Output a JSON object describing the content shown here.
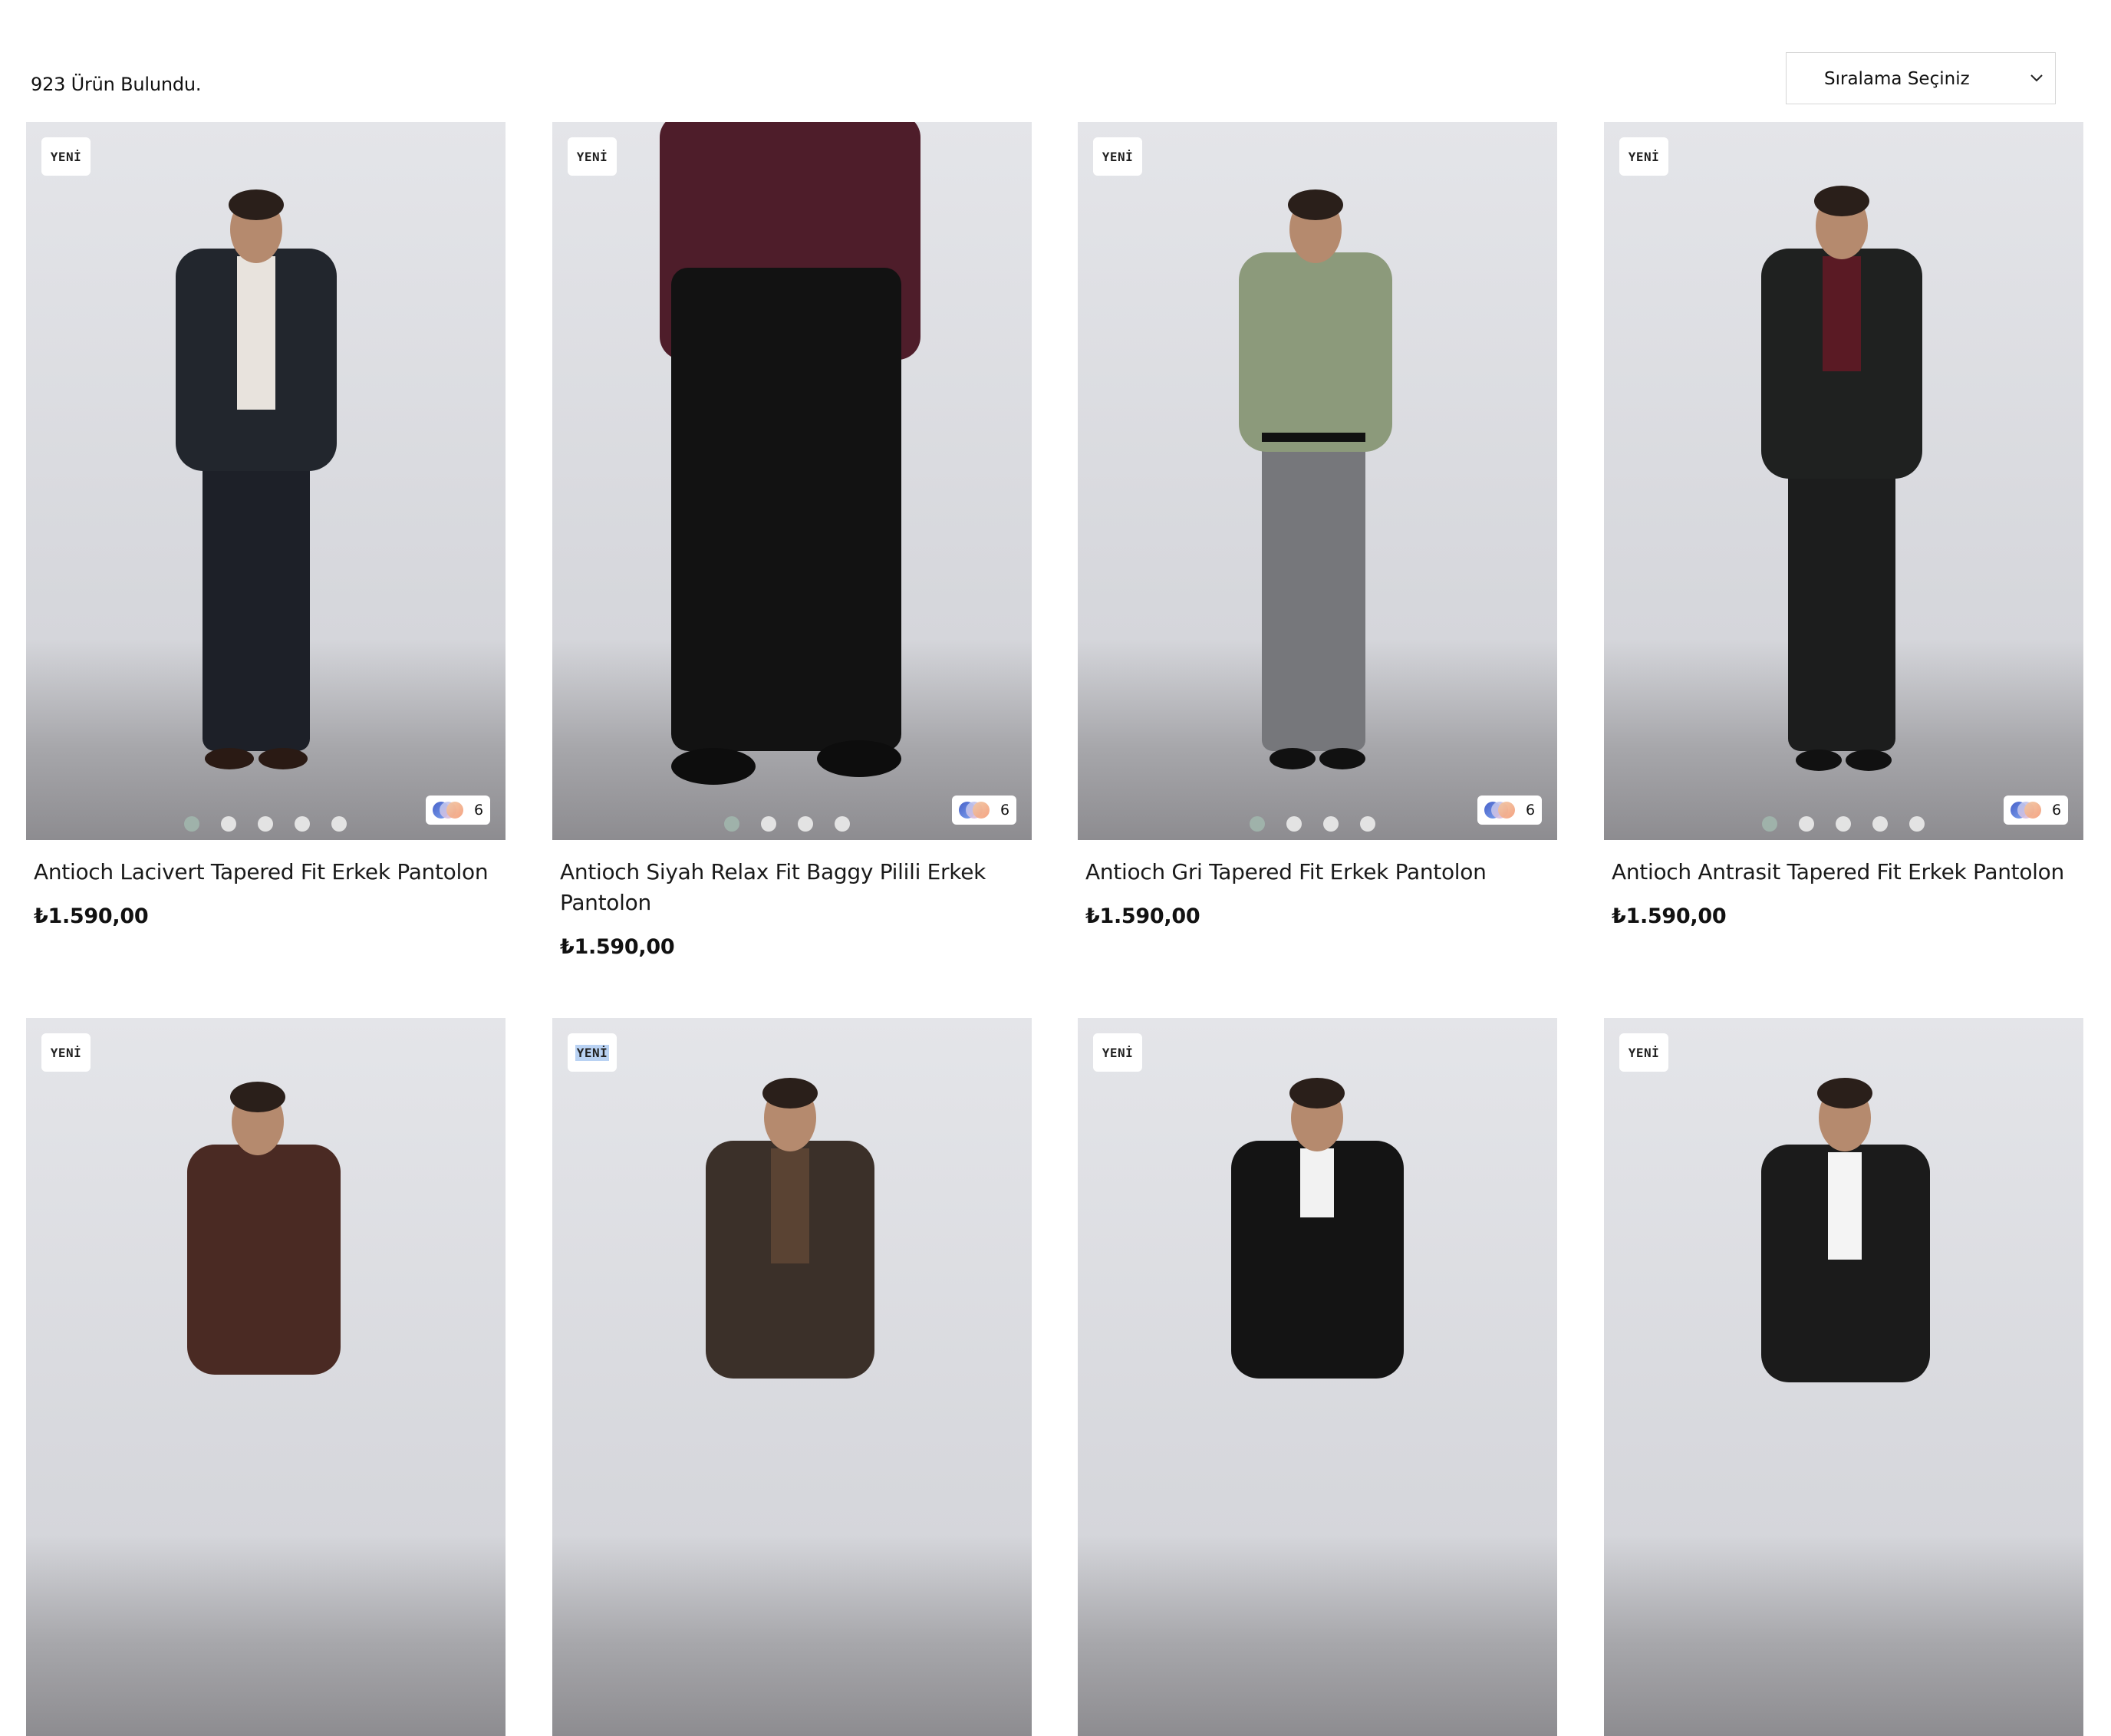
{
  "toolbar": {
    "result_count": "923 Ürün Bulundu.",
    "sort_label": "Sıralama Seçiniz"
  },
  "products": [
    {
      "badge": "YENİ",
      "name": "Antioch Lacivert Tapered Fit Erkek Pantolon",
      "price": "₺1.590,00",
      "color_count": "6",
      "image_count": 5,
      "top_color": "#e8e3dd",
      "jacket_color": "#22262d",
      "pants_color": "#1d2028"
    },
    {
      "badge": "YENİ",
      "name": "Antioch Siyah Relax Fit Baggy Pilili Erkek Pantolon",
      "price": "₺1.590,00",
      "color_count": "6",
      "image_count": 4,
      "top_color": "#4e1d2a",
      "jacket_color": "#4e1d2a",
      "pants_color": "#121212"
    },
    {
      "badge": "YENİ",
      "name": "Antioch Gri Tapered Fit Erkek Pantolon",
      "price": "₺1.590,00",
      "color_count": "6",
      "image_count": 4,
      "top_color": "#8c9a7b",
      "jacket_color": "#8c9a7b",
      "pants_color": "#76777b"
    },
    {
      "badge": "YENİ",
      "name": "Antioch Antrasit Tapered Fit Erkek Pantolon",
      "price": "₺1.590,00",
      "color_count": "6",
      "image_count": 5,
      "top_color": "#5a1a24",
      "jacket_color": "#1f2120",
      "pants_color": "#1c1d1d"
    },
    {
      "badge": "YENİ",
      "top_color": "#4a2a23",
      "jacket_color": "#4a2a23",
      "pants_color": "#2a2a2a"
    },
    {
      "badge": "YENİ",
      "top_color": "#5a4333",
      "jacket_color": "#3b3029",
      "pants_color": "#3b3029"
    },
    {
      "badge": "YENİ",
      "top_color": "#f2f2f2",
      "jacket_color": "#141414",
      "pants_color": "#141414"
    },
    {
      "badge": "YENİ",
      "top_color": "#f4f4f4",
      "jacket_color": "#1b1b1b",
      "pants_color": "#1b1b1b"
    }
  ]
}
